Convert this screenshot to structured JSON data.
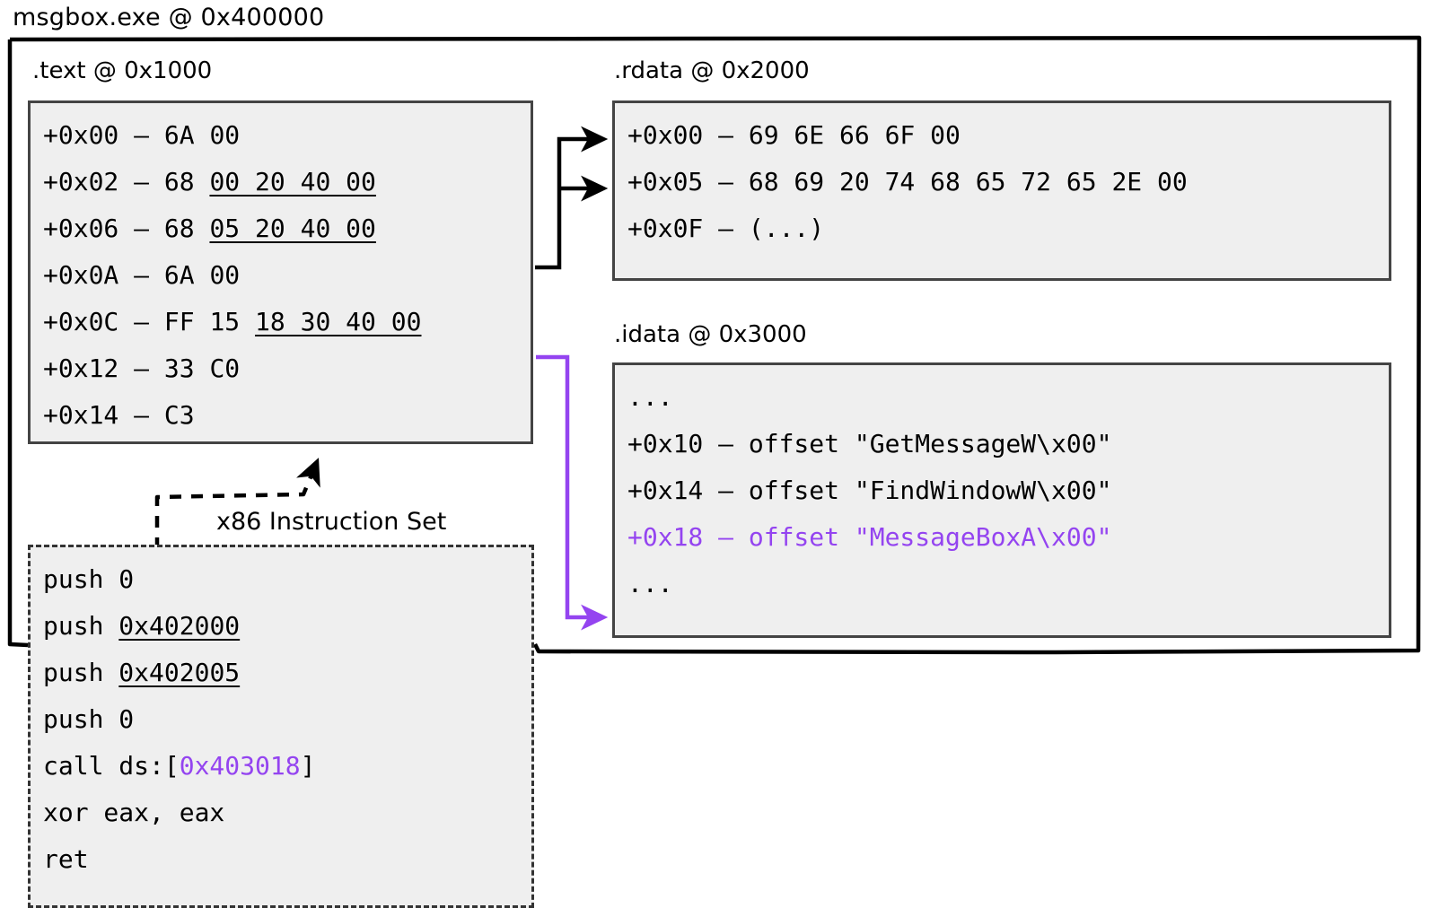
{
  "module": {
    "title": "msgbox.exe @ 0x400000"
  },
  "sections": {
    "text": {
      "label": ".text @ 0x1000",
      "rows": [
        {
          "offset": "+0x00",
          "dash": "–",
          "bytes": "6A 00",
          "ref": ""
        },
        {
          "offset": "+0x02",
          "dash": "–",
          "bytes": "68",
          "ref": "00 20 40 00"
        },
        {
          "offset": "+0x06",
          "dash": "–",
          "bytes": "68",
          "ref": "05 20 40 00"
        },
        {
          "offset": "+0x0A",
          "dash": "–",
          "bytes": "6A 00",
          "ref": ""
        },
        {
          "offset": "+0x0C",
          "dash": "–",
          "bytes": "FF 15",
          "ref": "18 30 40 00"
        },
        {
          "offset": "+0x12",
          "dash": "–",
          "bytes": "33 C0",
          "ref": ""
        },
        {
          "offset": "+0x14",
          "dash": "–",
          "bytes": "C3",
          "ref": ""
        }
      ]
    },
    "rdata": {
      "label": ".rdata @ 0x2000",
      "rows": [
        "+0x00 – 69 6E 66 6F 00",
        "+0x05 – 68 69 20 74 68 65 72 65 2E 00",
        "+0x0F – (...)"
      ]
    },
    "idata": {
      "label": ".idata @ 0x3000",
      "rows": [
        {
          "text": "...",
          "highlight": false
        },
        {
          "text": "+0x10 – offset \"GetMessageW\\x00\"",
          "highlight": false
        },
        {
          "text": "+0x14 – offset \"FindWindowW\\x00\"",
          "highlight": false
        },
        {
          "text": "+0x18 – offset \"MessageBoxA\\x00\"",
          "highlight": true
        },
        {
          "text": "...",
          "highlight": false
        }
      ]
    },
    "asm": {
      "callout_label": "x86 Instruction Set",
      "rows": [
        {
          "pre": "push 0",
          "underlined": "",
          "post": "",
          "accent": "",
          "tail": ""
        },
        {
          "pre": "push ",
          "underlined": "0x402000",
          "post": "",
          "accent": "",
          "tail": ""
        },
        {
          "pre": "push ",
          "underlined": "0x402005",
          "post": "",
          "accent": "",
          "tail": ""
        },
        {
          "pre": "push 0",
          "underlined": "",
          "post": "",
          "accent": "",
          "tail": ""
        },
        {
          "pre": "call ds:[",
          "underlined": "",
          "post": "",
          "accent": "0x403018",
          "tail": "]"
        },
        {
          "pre": "xor eax, eax",
          "underlined": "",
          "post": "",
          "accent": "",
          "tail": ""
        },
        {
          "pre": "ret",
          "underlined": "",
          "post": "",
          "accent": "",
          "tail": ""
        }
      ]
    }
  },
  "colors": {
    "accent_purple": "#9444f0",
    "panel_fill": "#efefef",
    "panel_border": "#444444",
    "line": "#000000"
  },
  "connectors": [
    {
      "name": "text-to-rdata-info",
      "style": "solid",
      "color": "#000000"
    },
    {
      "name": "text-to-rdata-string",
      "style": "solid",
      "color": "#000000"
    },
    {
      "name": "text-to-idata-iat",
      "style": "solid",
      "color": "#9444f0"
    },
    {
      "name": "asm-to-text",
      "style": "dashed",
      "color": "#000000"
    }
  ]
}
